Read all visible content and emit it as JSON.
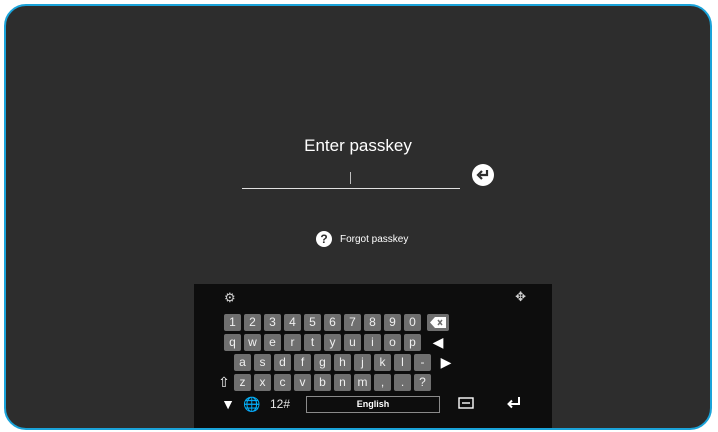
{
  "dialog": {
    "title": "Enter passkey",
    "forgot_label": "Forgot passkey",
    "forgot_icon": "?"
  },
  "keyboard": {
    "row1": [
      "1",
      "2",
      "3",
      "4",
      "5",
      "6",
      "7",
      "8",
      "9",
      "0"
    ],
    "row2": [
      "q",
      "w",
      "e",
      "r",
      "t",
      "y",
      "u",
      "i",
      "o",
      "p"
    ],
    "row3": [
      "a",
      "s",
      "d",
      "f",
      "g",
      "h",
      "j",
      "k",
      "l",
      "-"
    ],
    "row4": [
      "z",
      "x",
      "c",
      "v",
      "b",
      "n",
      "m",
      ",",
      ".",
      "?"
    ],
    "symbols_label": "12#",
    "space_label": "English"
  }
}
